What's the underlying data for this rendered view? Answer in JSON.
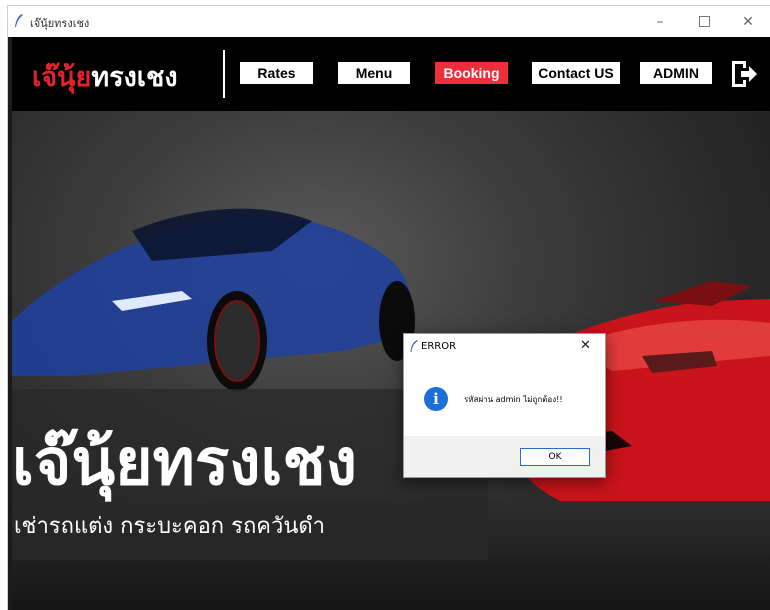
{
  "window": {
    "title": "เจ๊นุ้ยทรงเชง",
    "icon": "feather-icon",
    "controls": {
      "minimize": "–",
      "maximize": "",
      "close": "✕"
    }
  },
  "navbar": {
    "logo_red": "เจ๊นุ้ย",
    "logo_white": "ทรงเชง",
    "buttons": [
      {
        "label": "Rates",
        "active": false
      },
      {
        "label": "Menu",
        "active": false
      },
      {
        "label": "Booking",
        "active": true
      },
      {
        "label": "Contact US",
        "active": false
      },
      {
        "label": "ADMIN",
        "active": false
      }
    ],
    "exit_icon": "logout-icon",
    "accent_color": "#ee2f3a"
  },
  "hero": {
    "title": "เจ๊นุ้ยทรงเชง",
    "subtitle": "เช่ารถแต่ง กระบะคอก รถควันดำ"
  },
  "dialog": {
    "title": "ERROR",
    "close": "✕",
    "icon": "info-icon",
    "icon_glyph": "i",
    "message": "รหัสผ่าน admin ไม่ถูกต้อง!!",
    "ok_label": "OK"
  }
}
